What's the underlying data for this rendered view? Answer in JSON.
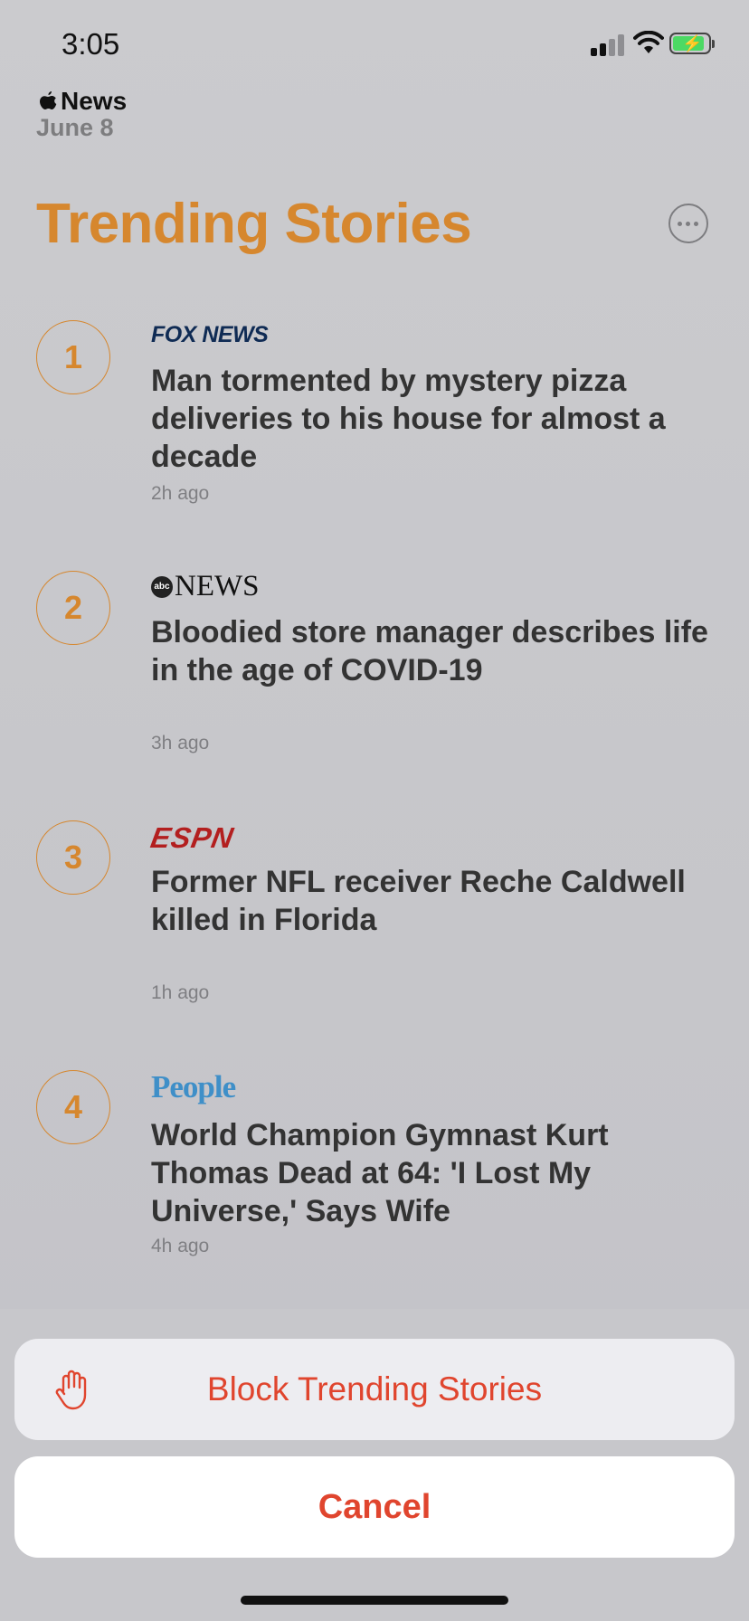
{
  "status_bar": {
    "time": "3:05"
  },
  "header": {
    "brand": "News",
    "date": "June 8",
    "title": "Trending Stories"
  },
  "stories": [
    {
      "rank": "1",
      "publisher": "FOX NEWS",
      "headline": "Man tormented by mystery pizza deliveries to his house for almost a decade",
      "age": "2h ago"
    },
    {
      "rank": "2",
      "publisher": "NEWS",
      "publisher_badge": "abc",
      "headline": "Bloodied store manager describes life in the age of COVID-19",
      "age": "3h ago"
    },
    {
      "rank": "3",
      "publisher": "ESPN",
      "headline": "Former NFL receiver Reche Caldwell killed in Florida",
      "age": "1h ago"
    },
    {
      "rank": "4",
      "publisher": "People",
      "headline": "World Champion Gymnast Kurt Thomas Dead at 64: 'I Lost My Universe,' Says Wife",
      "age": "4h ago"
    }
  ],
  "action_sheet": {
    "action_label": "Block Trending Stories",
    "action_icon": "hand-stop-icon",
    "cancel_label": "Cancel"
  },
  "colors": {
    "accent": "#d6872e",
    "destructive": "#e0452e",
    "fox_navy": "#0f2b54",
    "espn_red": "#b31f1f",
    "people_blue": "#3f8fc8"
  }
}
